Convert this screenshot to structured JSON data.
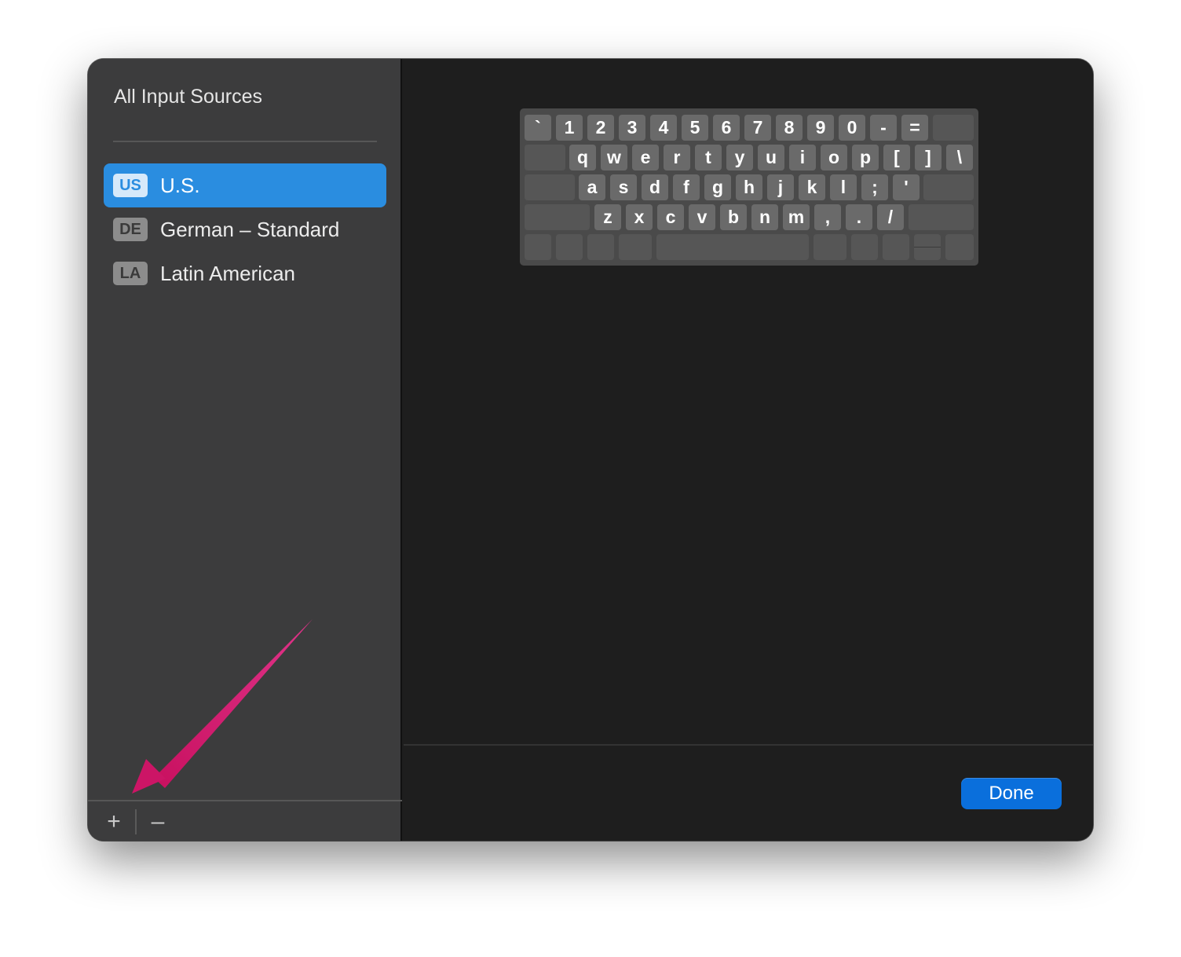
{
  "sidebar": {
    "title": "All Input Sources",
    "sources": [
      {
        "abbr": "US",
        "name": "U.S.",
        "selected": true
      },
      {
        "abbr": "DE",
        "name": "German – Standard",
        "selected": false
      },
      {
        "abbr": "LA",
        "name": "Latin American",
        "selected": false
      }
    ],
    "add_label": "+",
    "remove_label": "–"
  },
  "keyboard": {
    "row1": [
      "`",
      "1",
      "2",
      "3",
      "4",
      "5",
      "6",
      "7",
      "8",
      "9",
      "0",
      "-",
      "="
    ],
    "row2": [
      "q",
      "w",
      "e",
      "r",
      "t",
      "y",
      "u",
      "i",
      "o",
      "p",
      "[",
      "]",
      "\\"
    ],
    "row3": [
      "a",
      "s",
      "d",
      "f",
      "g",
      "h",
      "j",
      "k",
      "l",
      ";",
      "'"
    ],
    "row4": [
      "z",
      "x",
      "c",
      "v",
      "b",
      "n",
      "m",
      ",",
      ".",
      "/"
    ]
  },
  "footer": {
    "done_label": "Done"
  },
  "colors": {
    "accent": "#2a8de0",
    "done_button": "#0a6fdc",
    "annotation_arrow": "#d4166f"
  },
  "annotation": {
    "arrow_icon": "arrow-pointing-to-add-button"
  }
}
